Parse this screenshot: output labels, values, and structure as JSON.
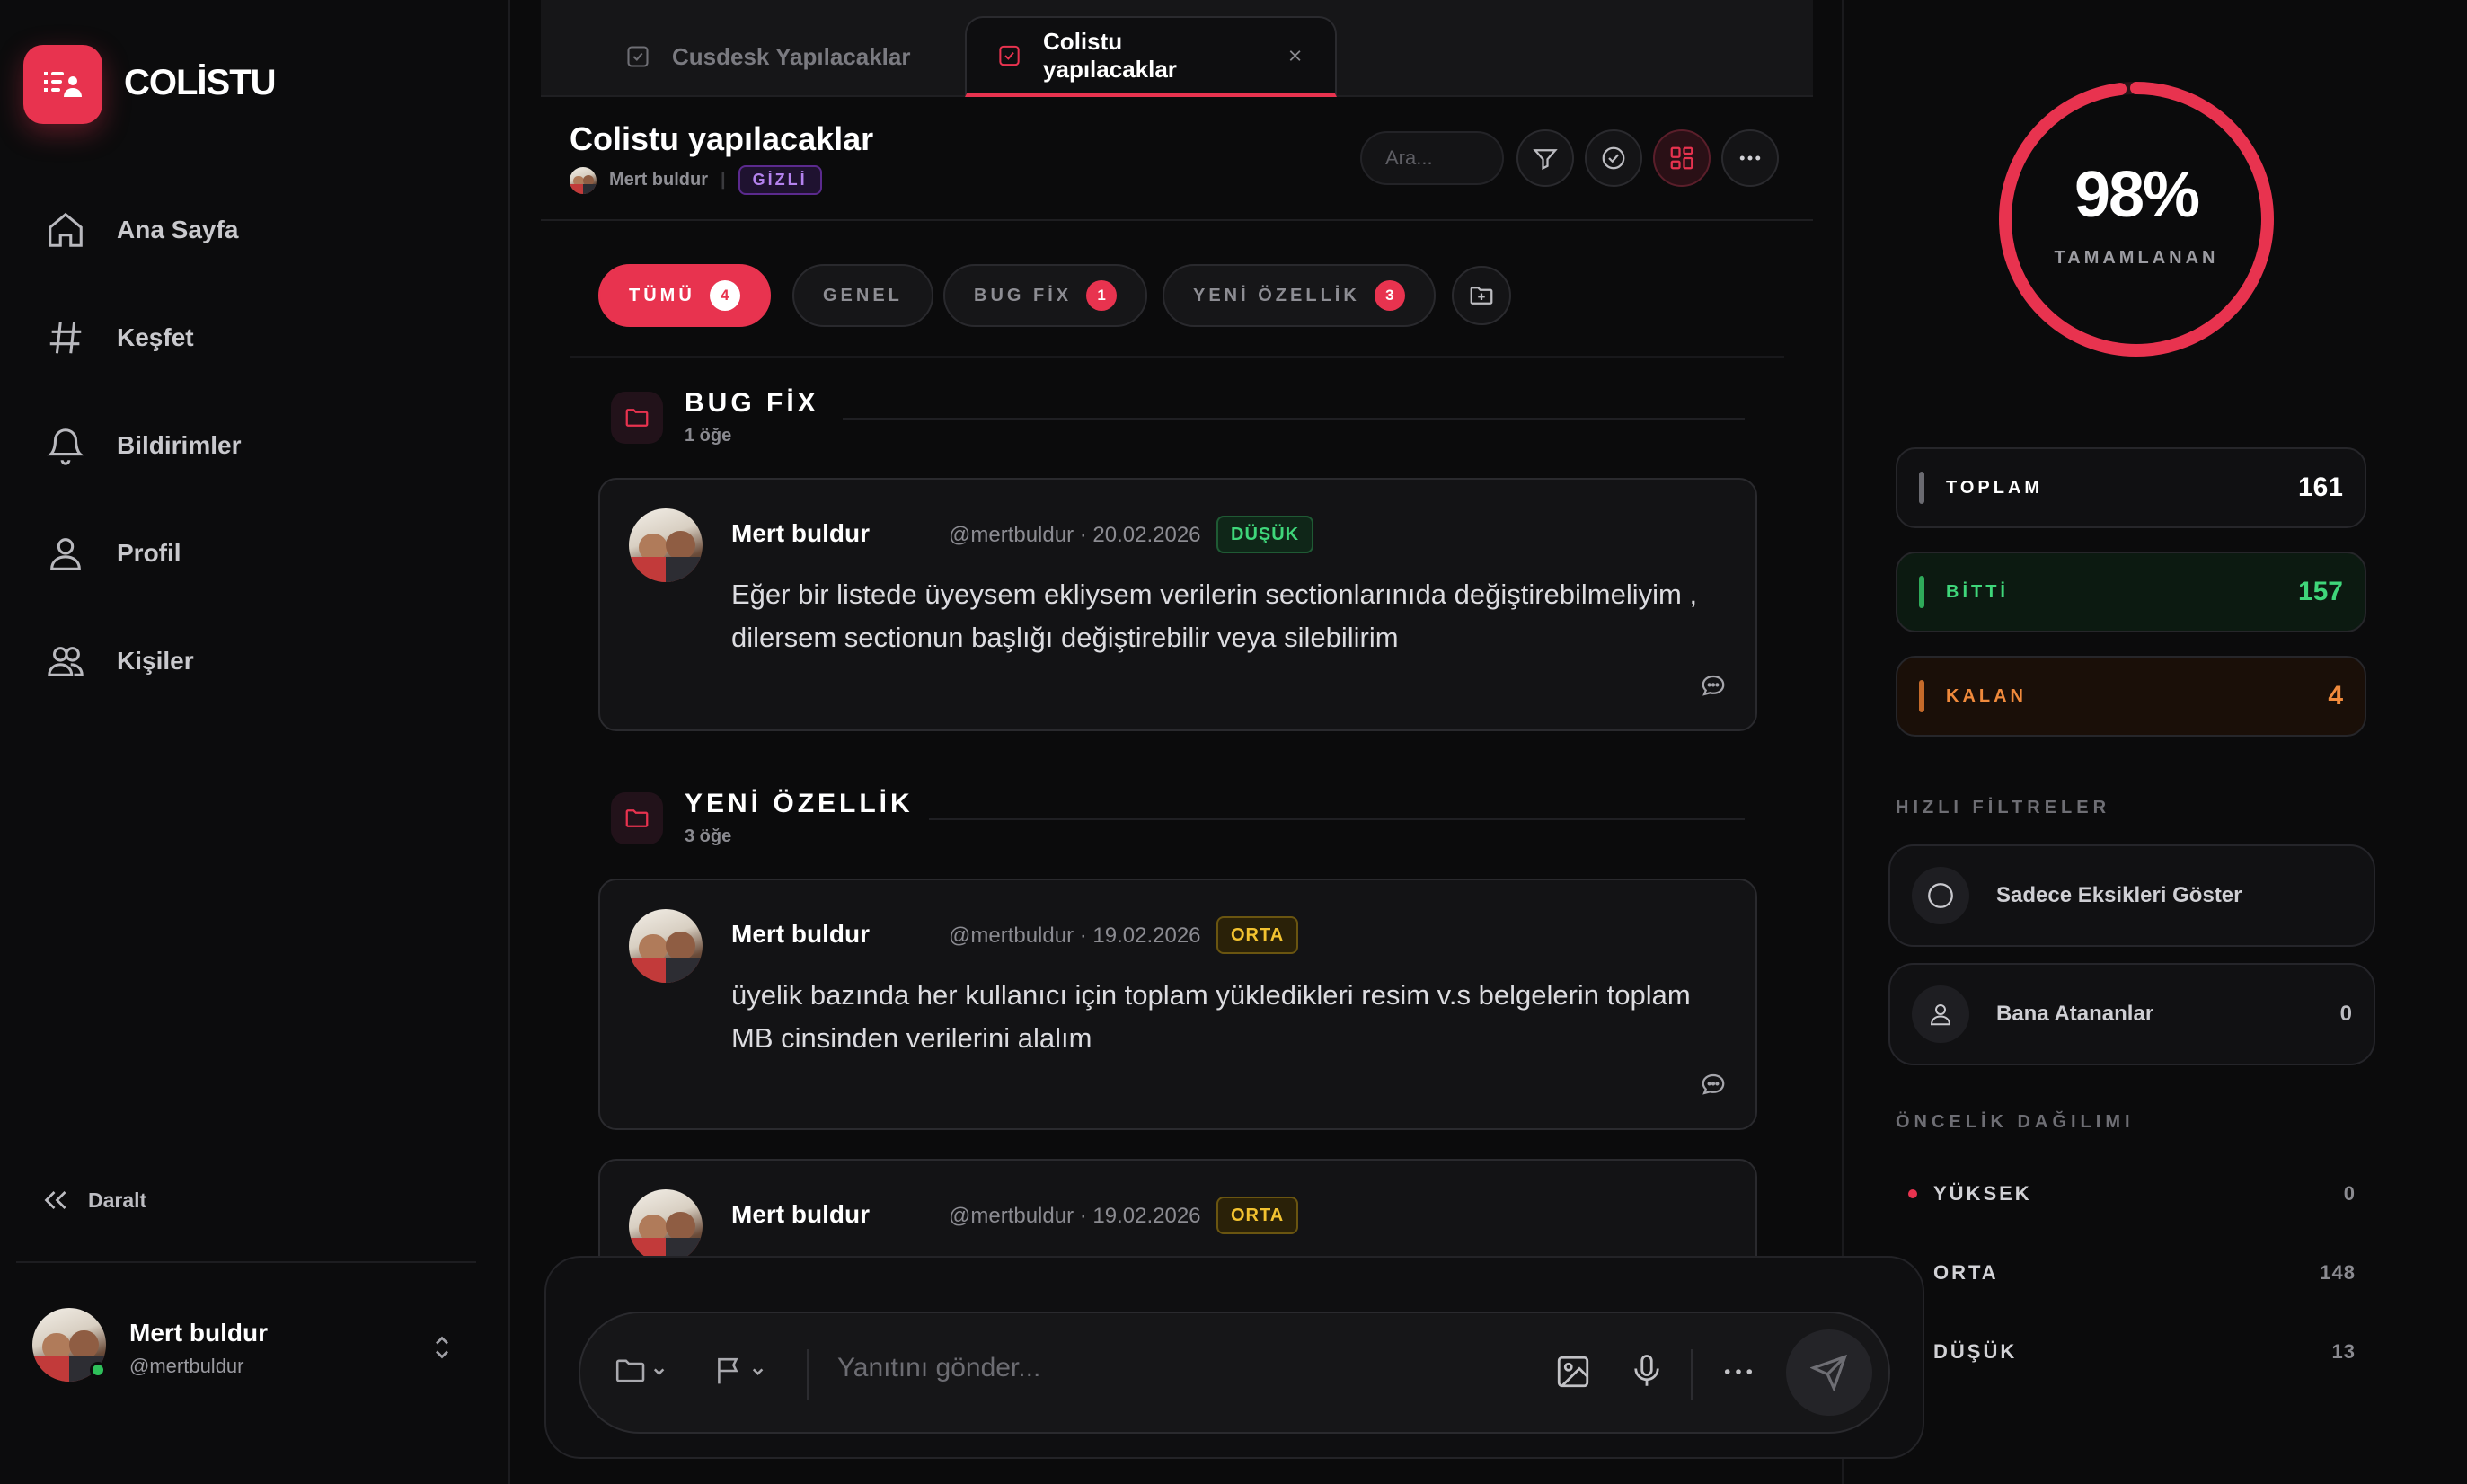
{
  "app": {
    "name": "COLİSTU",
    "accent": "#e8334f"
  },
  "sidebar": {
    "items": [
      {
        "label": "Ana Sayfa",
        "icon": "home-icon"
      },
      {
        "label": "Keşfet",
        "icon": "hash-icon"
      },
      {
        "label": "Bildirimler",
        "icon": "bell-icon"
      },
      {
        "label": "Profil",
        "icon": "user-icon"
      },
      {
        "label": "Kişiler",
        "icon": "users-icon"
      }
    ],
    "collapse_label": "Daralt",
    "user": {
      "name": "Mert buldur",
      "handle": "@mertbuldur",
      "online": true
    }
  },
  "tabs": [
    {
      "label": "Cusdesk Yapılacaklar",
      "icon": "checkbox-icon",
      "active": false
    },
    {
      "label": "Colistu yapılacaklar",
      "icon": "checkbox-icon",
      "active": true
    }
  ],
  "header": {
    "title": "Colistu yapılacaklar",
    "owner": "Mert buldur",
    "visibility_badge": "GİZLİ",
    "search_placeholder": "Ara..."
  },
  "chips": [
    {
      "label": "TÜMÜ",
      "count": "4",
      "active": true
    },
    {
      "label": "GENEL",
      "count": null,
      "active": false
    },
    {
      "label": "BUG FİX",
      "count": "1",
      "active": false
    },
    {
      "label": "YENİ ÖZELLİK",
      "count": "3",
      "active": false
    }
  ],
  "sections": [
    {
      "title": "BUG FİX",
      "count_label": "1 öğe",
      "items": [
        {
          "author": "Mert buldur",
          "meta": "@mertbuldur · 20.02.2026",
          "priority": "DÜŞÜK",
          "text": "Eğer bir listede üyeysem ekliysem verilerin sectionlarınıda değiştirebilmeliyim , dilersem sectionun başlığı değiştirebilir veya silebilirim"
        }
      ]
    },
    {
      "title": "YENİ ÖZELLİK",
      "count_label": "3 öğe",
      "items": [
        {
          "author": "Mert buldur",
          "meta": "@mertbuldur · 19.02.2026",
          "priority": "ORTA",
          "text": "üyelik bazında her kullanıcı için toplam yükledikleri resim v.s belgelerin toplam MB cinsinden verilerini alalım"
        },
        {
          "author": "Mert buldur",
          "meta": "@mertbuldur · 19.02.2026",
          "priority": "ORTA",
          "text": ""
        }
      ]
    }
  ],
  "composer": {
    "placeholder": "Yanıtını gönder..."
  },
  "progress": {
    "percent_label": "98%",
    "percent": 98,
    "label": "TAMAMLANAN"
  },
  "stats": [
    {
      "label": "TOPLAM",
      "value": "161",
      "color": "#ffffff",
      "bar": "#6a6a70",
      "bg": "#101012"
    },
    {
      "label": "BİTTİ",
      "value": "157",
      "color": "#3fd67a",
      "bar": "#2faa5a",
      "bg": "#0c1a11"
    },
    {
      "label": "KALAN",
      "value": "4",
      "color": "#f08a3c",
      "bar": "#c46a2a",
      "bg": "#1a0f08"
    }
  ],
  "quick_filters": {
    "heading": "HIZLI FİLTRELER",
    "items": [
      {
        "label": "Sadece Eksikleri Göster",
        "count": ""
      },
      {
        "label": "Bana Atananlar",
        "count": "0"
      }
    ]
  },
  "priority_distribution": {
    "heading": "ÖNCELİK DAĞILIMI",
    "rows": [
      {
        "label": "YÜKSEK",
        "value": "0",
        "color": "#e8334f"
      },
      {
        "label": "ORTA",
        "value": "148",
        "color": "#f2c230"
      },
      {
        "label": "DÜŞÜK",
        "value": "13",
        "color": "#3fd67a"
      }
    ]
  }
}
